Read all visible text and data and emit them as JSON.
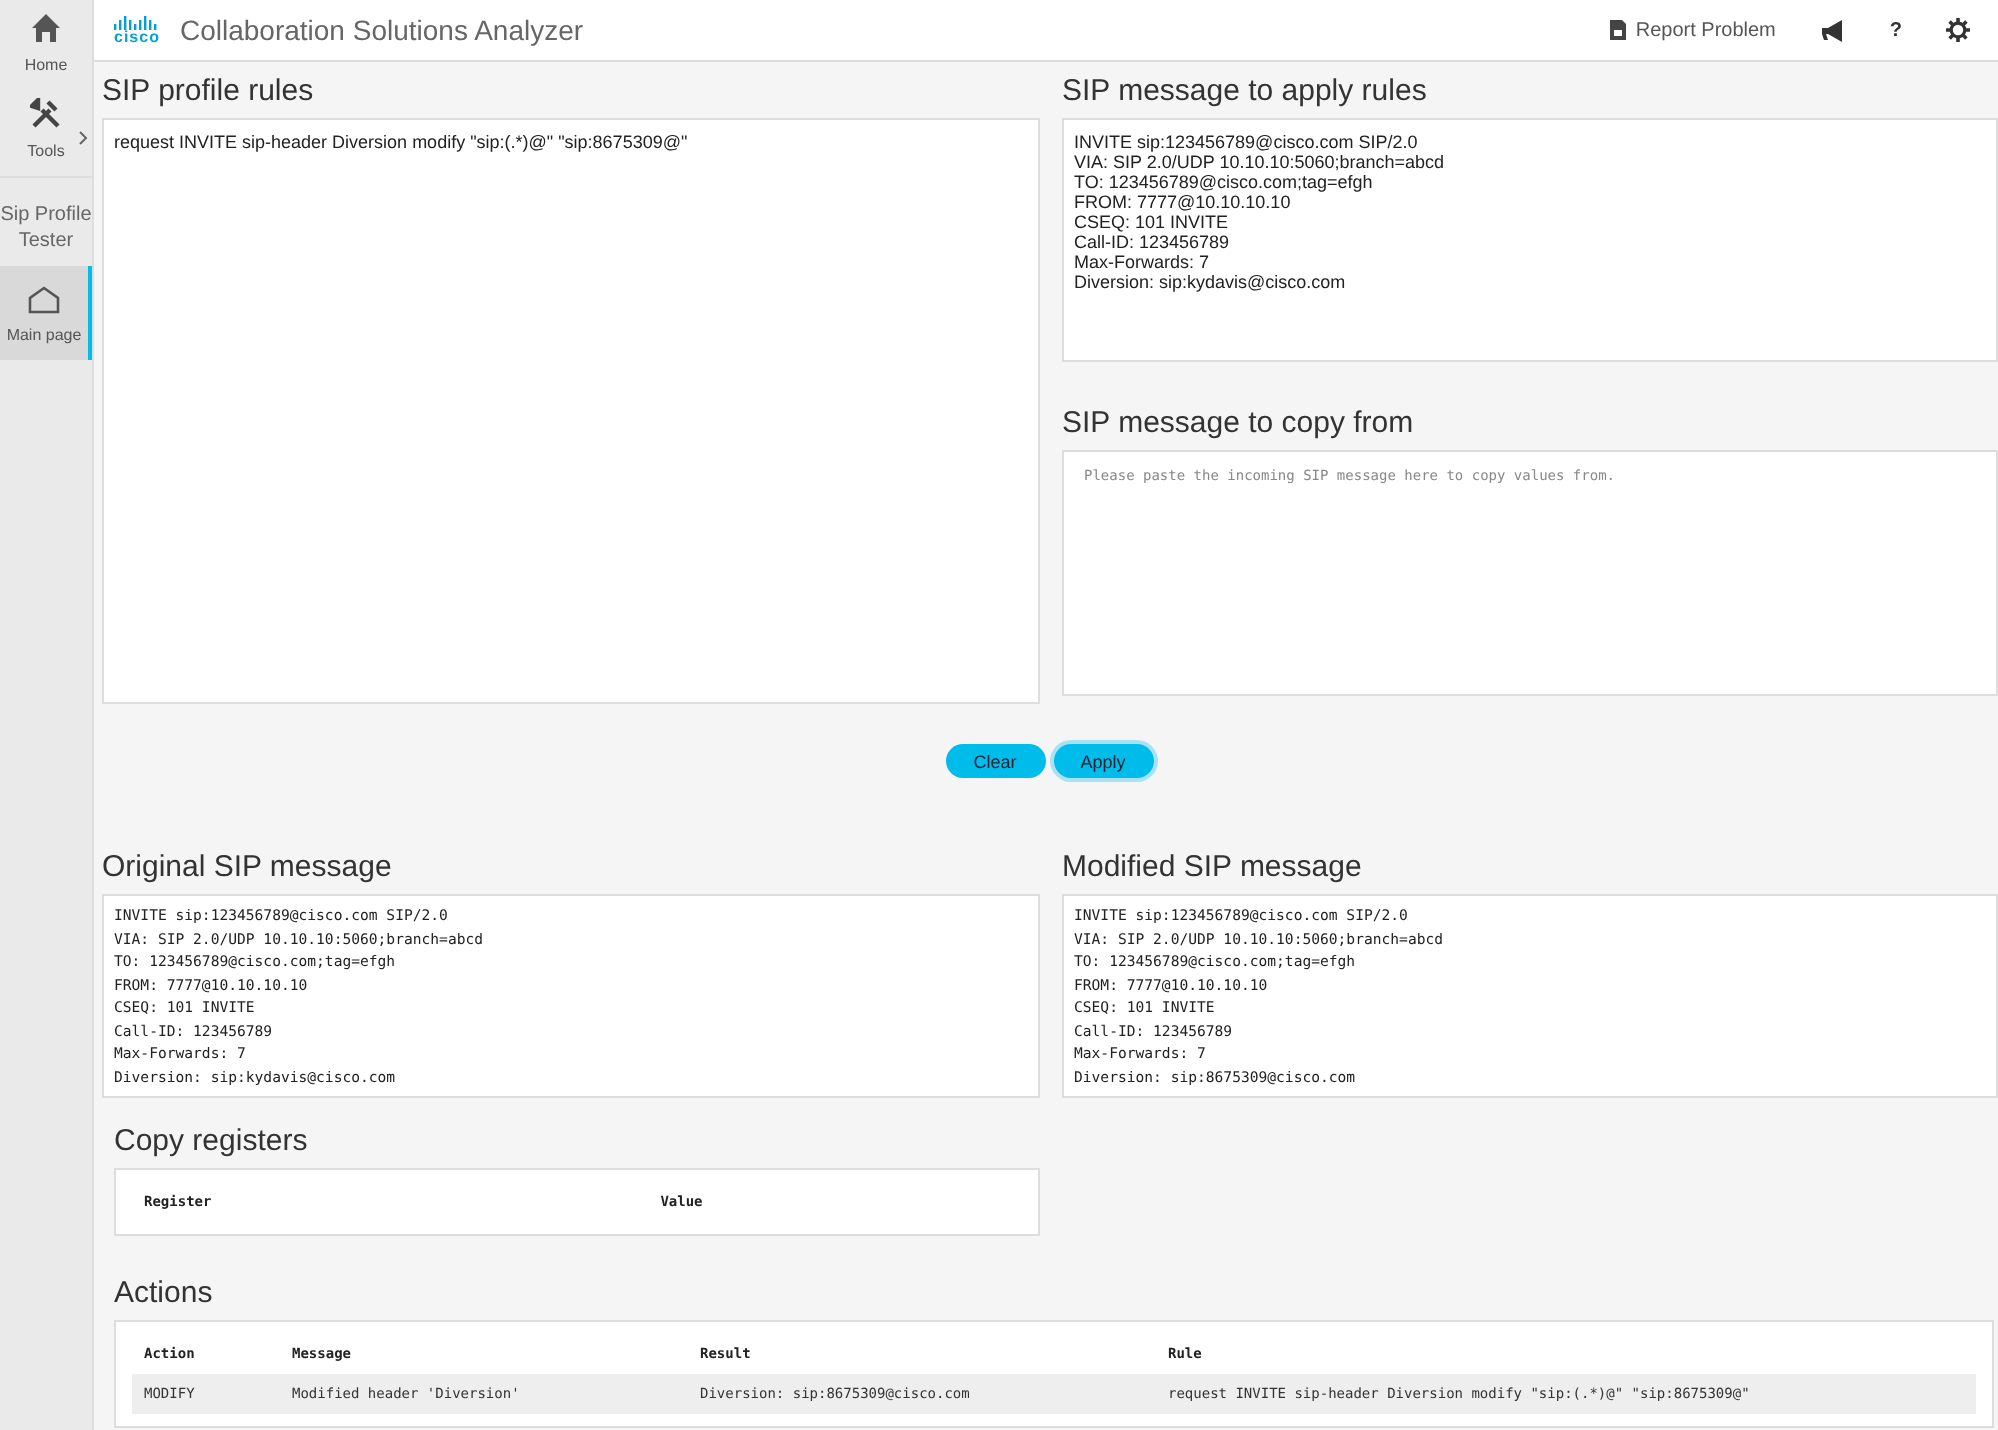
{
  "sidebar": {
    "items": [
      {
        "kind": "home",
        "label": "Home",
        "selected": false,
        "expandable": false
      },
      {
        "kind": "tools",
        "label": "Tools",
        "selected": false,
        "expandable": true
      }
    ],
    "section_title": "Sip Profile Tester",
    "sub_items": [
      {
        "kind": "page",
        "label": "Main page",
        "selected": true
      }
    ]
  },
  "header": {
    "logo_text": "cisco",
    "title": "Collaboration Solutions Analyzer",
    "actions": [
      {
        "kind": "report",
        "label": "Report Problem"
      },
      {
        "kind": "announce"
      },
      {
        "kind": "help",
        "label": "?"
      },
      {
        "kind": "settings"
      }
    ]
  },
  "sip_profile_rules": {
    "title": "SIP profile rules",
    "value": "request INVITE sip-header Diversion modify \"sip:(.*)@\" \"sip:8675309@\""
  },
  "apply_message": {
    "title": "SIP message to apply rules",
    "lines": [
      "INVITE sip:123456789@cisco.com SIP/2.0",
      "VIA: SIP 2.0/UDP 10.10.10:5060;branch=abcd",
      "TO: 123456789@cisco.com;tag=efgh",
      "FROM: 7777@10.10.10.10",
      "CSEQ: 101 INVITE",
      "Call-ID: 123456789",
      "Max-Forwards: 7",
      "Diversion: sip:kydavis@cisco.com"
    ]
  },
  "copy_message": {
    "title": "SIP message to copy from",
    "placeholder": "Please paste the incoming SIP message here to copy values from."
  },
  "buttons": [
    {
      "label": "Clear",
      "focused": false
    },
    {
      "label": "Apply",
      "focused": true
    }
  ],
  "original_message": {
    "title": "Original SIP message",
    "lines": [
      "INVITE sip:123456789@cisco.com SIP/2.0",
      "VIA: SIP 2.0/UDP 10.10.10:5060;branch=abcd",
      "TO: 123456789@cisco.com;tag=efgh",
      "FROM: 7777@10.10.10.10",
      "CSEQ: 101 INVITE",
      "Call-ID: 123456789",
      "Max-Forwards: 7",
      "Diversion: sip:kydavis@cisco.com"
    ]
  },
  "modified_message": {
    "title": "Modified SIP message",
    "lines": [
      "INVITE sip:123456789@cisco.com SIP/2.0",
      "VIA: SIP 2.0/UDP 10.10.10:5060;branch=abcd",
      "TO: 123456789@cisco.com;tag=efgh",
      "FROM: 7777@10.10.10.10",
      "CSEQ: 101 INVITE",
      "Call-ID: 123456789",
      "Max-Forwards: 7",
      "Diversion: sip:8675309@cisco.com"
    ]
  },
  "copy_registers": {
    "title": "Copy registers",
    "columns": [
      "Register",
      "Value"
    ]
  },
  "actions": {
    "title": "Actions",
    "columns": [
      "Action",
      "Message",
      "Result",
      "Rule"
    ],
    "rows": [
      [
        "MODIFY",
        "Modified header 'Diversion'",
        "Diversion: sip:8675309@cisco.com",
        "request INVITE sip-header Diversion modify \"sip:(.*)@\" \"sip:8675309@\""
      ]
    ]
  }
}
